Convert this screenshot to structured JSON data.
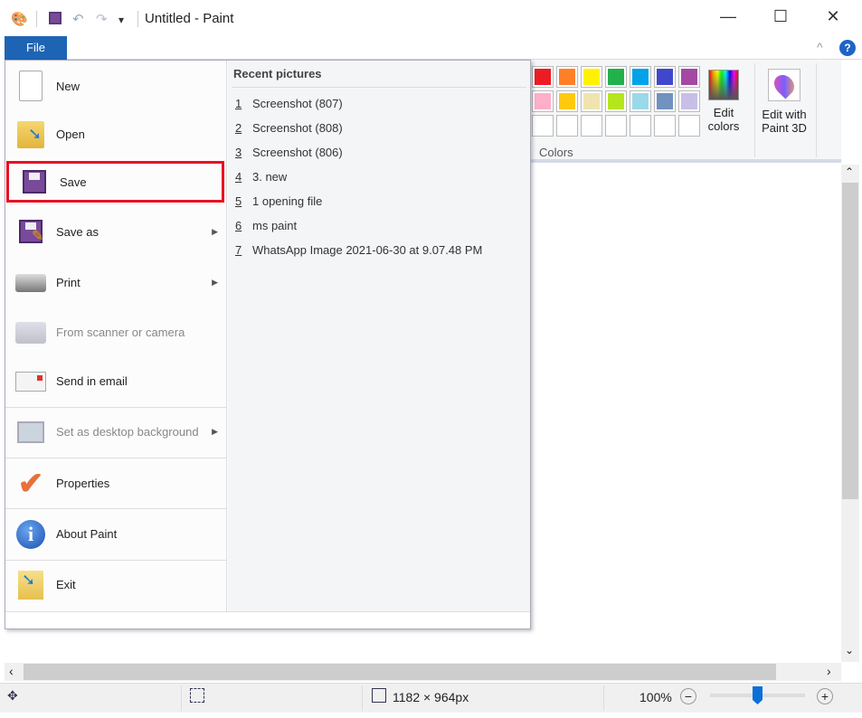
{
  "window": {
    "title": "Untitled - Paint",
    "minimize": "—",
    "maximize": "☐",
    "close": "✕",
    "collapse": "^",
    "help": "?"
  },
  "quick_access": {
    "save_icon": "floppy-icon",
    "undo": "↶",
    "redo": "↷",
    "customize": "▾"
  },
  "file_tab": "File",
  "ribbon": {
    "colors_label": "Colors",
    "palette_row1": [
      "#ed1c24",
      "#ff7f27",
      "#fff200",
      "#22b14c",
      "#00a2e8",
      "#3f48cc",
      "#a349a4"
    ],
    "palette_row2": [
      "#ffaec9",
      "#ffc90e",
      "#efe4b0",
      "#b5e61d",
      "#99d9ea",
      "#7092be",
      "#c8bfe7"
    ],
    "edit_colors": [
      "Edit",
      "colors"
    ],
    "edit_paint3d": [
      "Edit with",
      "Paint 3D"
    ]
  },
  "file_menu": {
    "items": [
      {
        "label": "New",
        "icon": "new-file-icon"
      },
      {
        "label": "Open",
        "icon": "open-folder-icon"
      },
      {
        "label": "Save",
        "icon": "save-icon",
        "highlighted": true
      },
      {
        "label": "Save as",
        "icon": "save-as-icon",
        "submenu": true
      },
      {
        "label": "Print",
        "icon": "printer-icon",
        "submenu": true
      },
      {
        "label": "From scanner or camera",
        "icon": "scanner-icon",
        "disabled": true
      },
      {
        "label": "Send in email",
        "icon": "email-icon"
      },
      {
        "label": "Set as desktop background",
        "icon": "desktop-icon",
        "disabled": true,
        "submenu": true
      },
      {
        "label": "Properties",
        "icon": "checkmark-icon"
      },
      {
        "label": "About Paint",
        "icon": "info-icon"
      },
      {
        "label": "Exit",
        "icon": "exit-icon"
      }
    ],
    "recent_title": "Recent pictures",
    "recent": [
      {
        "n": "1",
        "name": "Screenshot (807)"
      },
      {
        "n": "2",
        "name": "Screenshot (808)"
      },
      {
        "n": "3",
        "name": "Screenshot (806)"
      },
      {
        "n": "4",
        "name": "3. new"
      },
      {
        "n": "5",
        "name": "1 opening file"
      },
      {
        "n": "6",
        "name": "ms paint"
      },
      {
        "n": "7",
        "name": "WhatsApp Image 2021-06-30 at 9.07.48 PM"
      }
    ],
    "highlight_color": "#e81123"
  },
  "status": {
    "image_size": "1182 × 964px",
    "zoom": "100%",
    "zoom_level_percent": 100
  }
}
